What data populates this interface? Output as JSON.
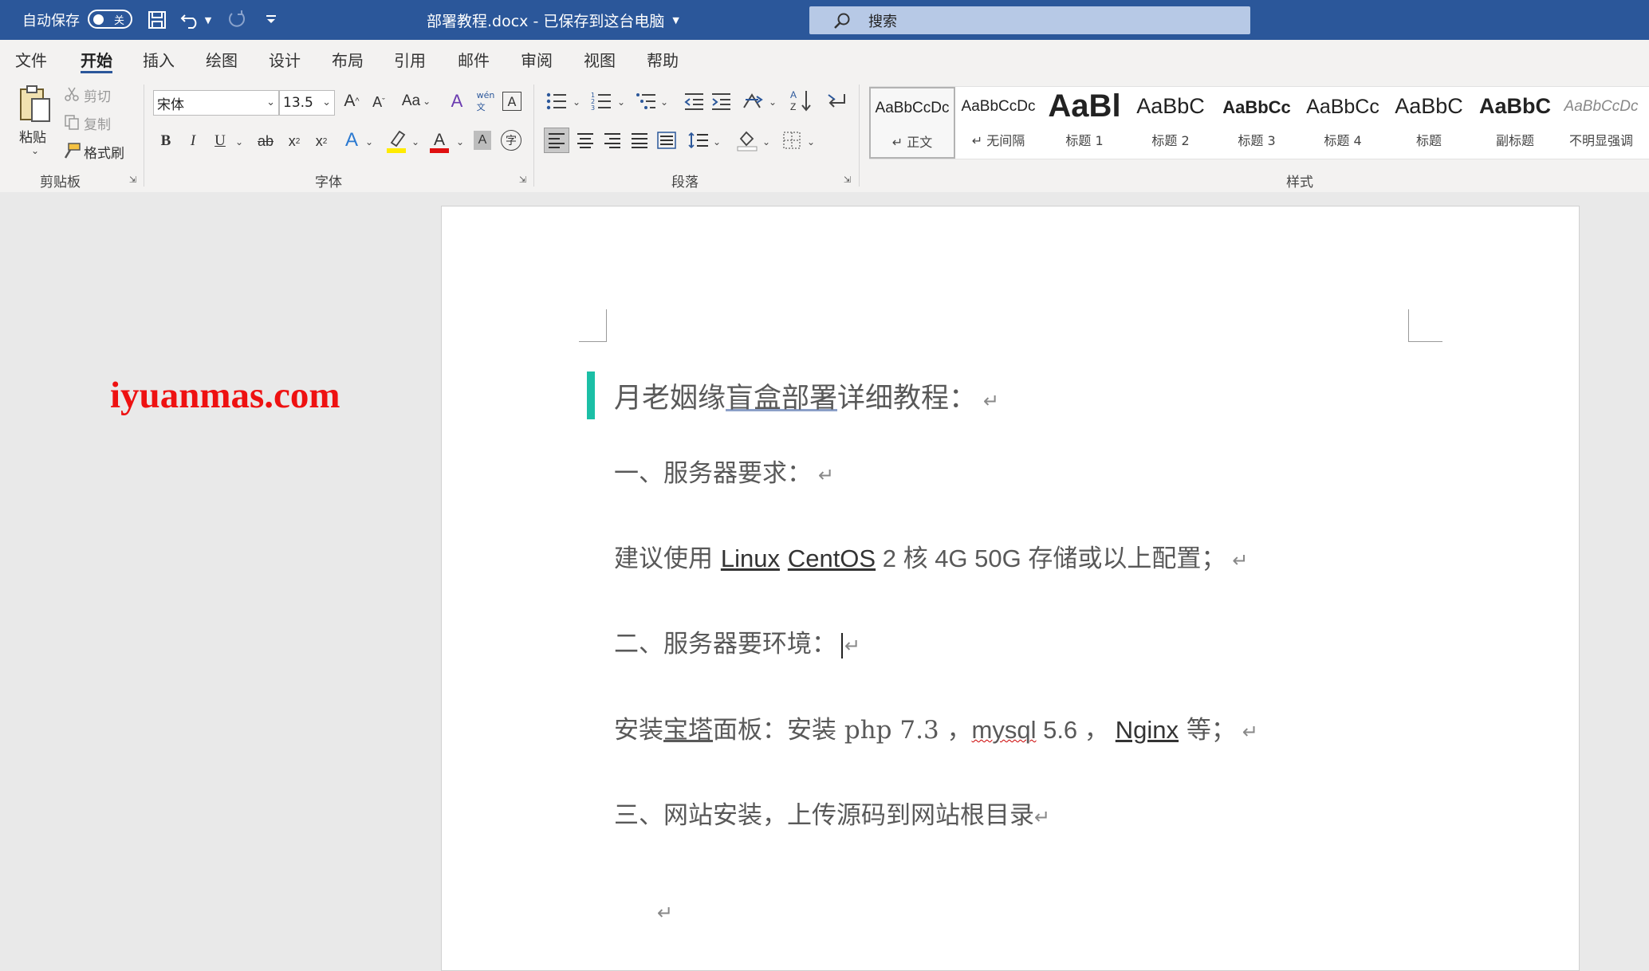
{
  "titlebar": {
    "autosave_label": "自动保存",
    "autosave_state": "关",
    "doc_title": "部署教程.docx  -  已保存到这台电脑",
    "search_placeholder": "搜索",
    "bg_color": "#2b579a"
  },
  "menu": {
    "tabs": [
      {
        "label": "文件"
      },
      {
        "label": "开始",
        "active": true
      },
      {
        "label": "插入"
      },
      {
        "label": "绘图"
      },
      {
        "label": "设计"
      },
      {
        "label": "布局"
      },
      {
        "label": "引用"
      },
      {
        "label": "邮件"
      },
      {
        "label": "审阅"
      },
      {
        "label": "视图"
      },
      {
        "label": "帮助"
      }
    ]
  },
  "ribbon": {
    "clipboard": {
      "label": "剪贴板",
      "paste": "粘贴",
      "cut": "剪切",
      "copy": "复制",
      "format_painter": "格式刷"
    },
    "font": {
      "label": "字体",
      "font_name": "宋体",
      "font_size": "13.5",
      "change_case": "Aa"
    },
    "paragraph": {
      "label": "段落"
    },
    "styles": {
      "label": "样式",
      "items": [
        {
          "sample": "AaBbCcDc",
          "name": "↵ 正文"
        },
        {
          "sample": "AaBbCcDc",
          "name": "↵ 无间隔"
        },
        {
          "sample": "AaBl",
          "name": "标题 1"
        },
        {
          "sample": "AaBbC",
          "name": "标题 2"
        },
        {
          "sample": "AaBbCc",
          "name": "标题 3"
        },
        {
          "sample": "AaBbCc",
          "name": "标题 4"
        },
        {
          "sample": "AaBbC",
          "name": "标题"
        },
        {
          "sample": "AaBbC",
          "name": "副标题"
        },
        {
          "sample": "AaBbCcDc",
          "name": "不明显强调"
        }
      ]
    }
  },
  "watermark": "iyuanmas.com",
  "document": {
    "heading": {
      "a": "月老姻缘",
      "b": "盲盒部署",
      "c": "详细教程："
    },
    "p1": "一、服务器要求：",
    "p2": {
      "a": "建议使用 ",
      "b": "Linux",
      "c": " ",
      "d": "CentOS",
      "e": " 2 核 4G 50G 存储或以上配置；"
    },
    "p3": "二、服务器要环境：",
    "p4": {
      "a": "安装",
      "b": "宝塔",
      "c": "面板：安装 php 7.3 ，",
      "d": "mysql",
      "e": " 5.6 ，",
      "f": "Nginx",
      "g": " 等；"
    },
    "p5": "三、网站安装，上传源码到网站根目录",
    "paragraph_mark": "↵"
  },
  "colors": {
    "accent": "#2b579a",
    "watermark": "#e11111",
    "heading_bar": "#1bbfa6"
  }
}
